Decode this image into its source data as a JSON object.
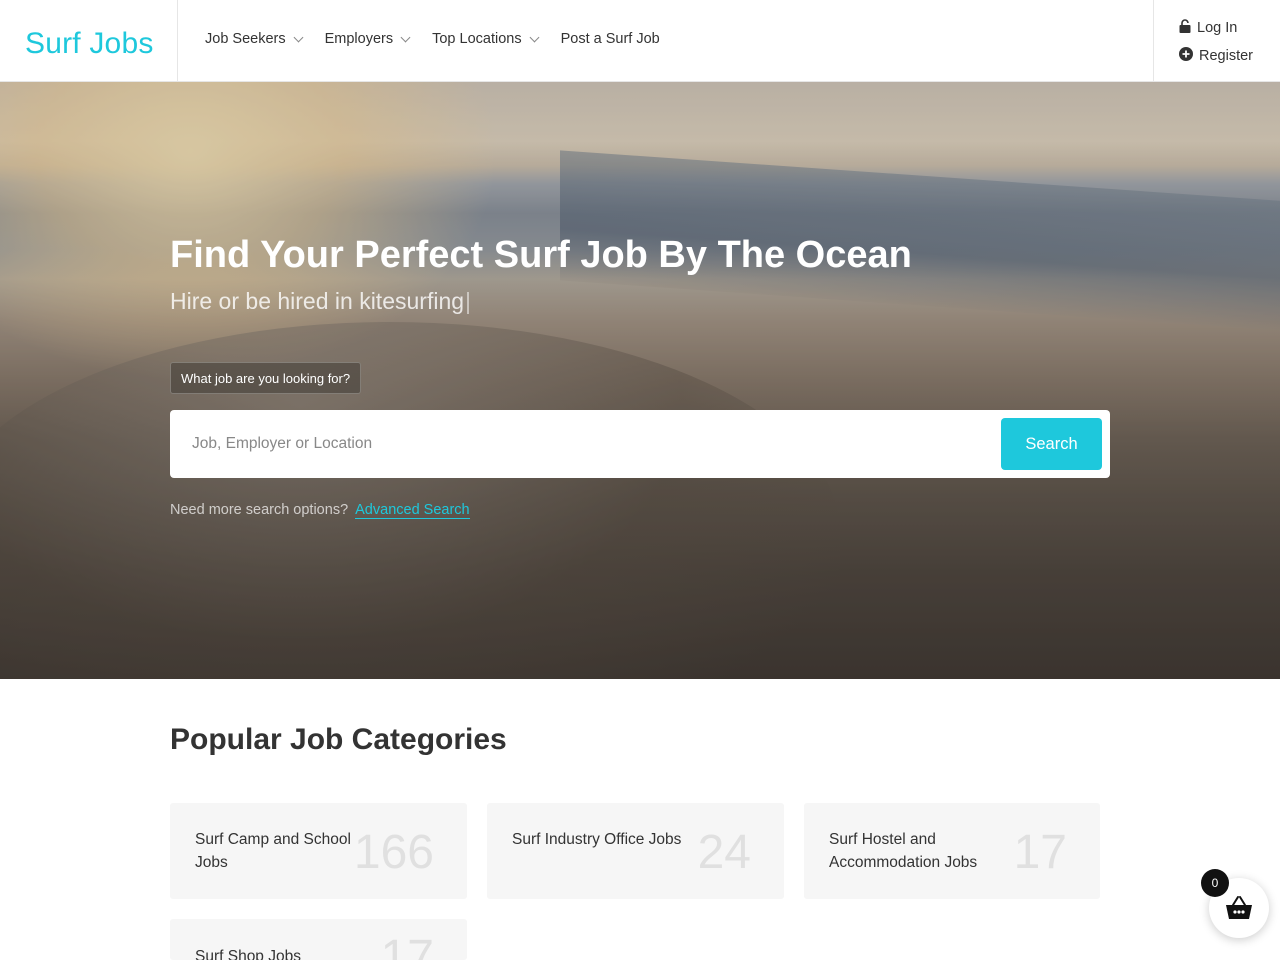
{
  "header": {
    "logo": "Surf Jobs",
    "nav": [
      {
        "label": "Job Seekers",
        "dropdown": true
      },
      {
        "label": "Employers",
        "dropdown": true
      },
      {
        "label": "Top Locations",
        "dropdown": true
      },
      {
        "label": "Post a Surf Job",
        "dropdown": false
      }
    ],
    "login_label": "Log In",
    "register_label": "Register"
  },
  "hero": {
    "title": "Find Your Perfect Surf Job By The Ocean",
    "subtitle": "Hire or be hired in kitesurfing",
    "search_label": "What job are you looking for?",
    "search_placeholder": "Job, Employer or Location",
    "search_value": "",
    "search_button": "Search",
    "more_options_text": "Need more search options?",
    "advanced_search_link": "Advanced Search"
  },
  "categories": {
    "title": "Popular Job Categories",
    "items": [
      {
        "name": "Surf Camp and School Jobs",
        "count": "166"
      },
      {
        "name": "Surf Industry Office Jobs",
        "count": "24"
      },
      {
        "name": "Surf Hostel and Accommodation Jobs",
        "count": "17"
      },
      {
        "name": "Surf Shop Jobs",
        "count": "17"
      }
    ]
  },
  "cart": {
    "count": "0"
  },
  "colors": {
    "accent": "#1ec8dc",
    "card_bg": "#f6f6f6",
    "count_text": "#e0e0e0"
  }
}
